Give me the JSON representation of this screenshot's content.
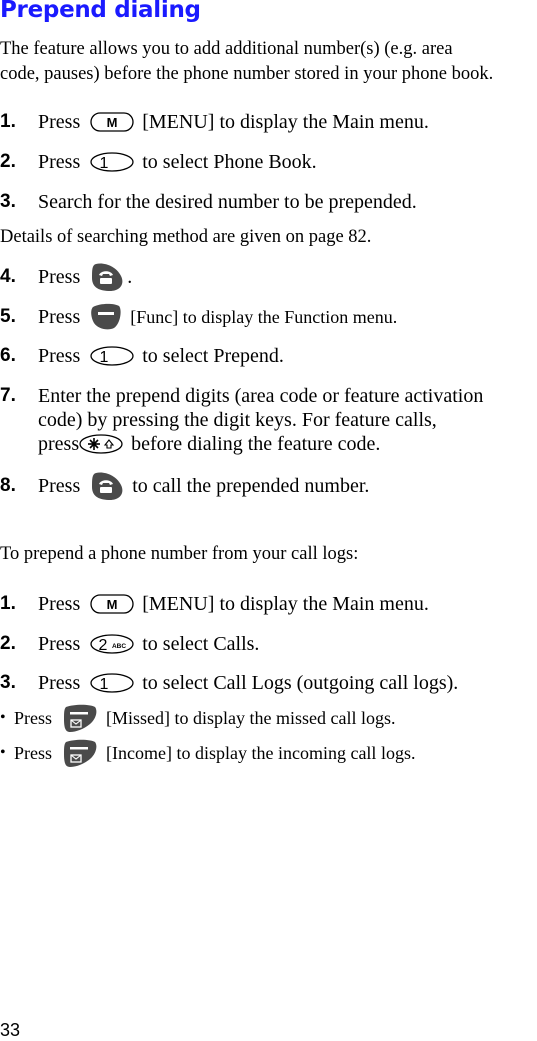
{
  "title": "Prepend dialing",
  "intro": {
    "line1": "The feature allows you to add additional number(s) (e.g. area",
    "line2": "code, pauses) before the phone number stored in your phone book."
  },
  "section1": {
    "steps": [
      {
        "num": "1.",
        "prefix": "Press",
        "key": "menu-key",
        "key_label": "M",
        "suffix": "[MENU] to display the Main menu."
      },
      {
        "num": "2.",
        "prefix": "Press",
        "key": "digit-1-key",
        "key_label": "1",
        "suffix": "to select Phone Book."
      },
      {
        "num": "3.",
        "text": "Search for the desired number to be prepended."
      },
      {
        "num": "4.",
        "prefix": "Press",
        "key": "send-key",
        "suffix": "."
      },
      {
        "num": "5.",
        "prefix": "Press",
        "key": "function-soft-key",
        "suffix": "[Func] to display the Function menu."
      },
      {
        "num": "6.",
        "prefix": "Press",
        "key": "digit-1-key",
        "key_label": "1",
        "suffix": "to select Prepend."
      },
      {
        "num": "7.",
        "line1": "Enter the prepend digits (area code or feature activation",
        "line2": "code) by pressing the digit keys. For feature calls,",
        "line3_prefix": "press",
        "key": "star-key",
        "line3_suffix": "before dialing the feature code."
      },
      {
        "num": "8.",
        "prefix": "Press",
        "key": "send-key",
        "suffix": "to call the prepended number."
      }
    ],
    "note": "Details of searching method are given on page 82."
  },
  "section2": {
    "intro": "To prepend a phone number from your call logs:",
    "steps": [
      {
        "num": "1.",
        "prefix": "Press",
        "key": "menu-key",
        "key_label": "M",
        "suffix": "[MENU] to display the Main menu."
      },
      {
        "num": "2.",
        "prefix": "Press",
        "key": "digit-2-key",
        "key_label": "2",
        "key_sub": "ABC",
        "suffix": "to select Calls."
      },
      {
        "num": "3.",
        "prefix": "Press",
        "key": "digit-1-key",
        "key_label": "1",
        "suffix": "to select Call Logs (outgoing call logs)."
      }
    ],
    "bullets": [
      {
        "bullet": "•",
        "prefix": "Press",
        "key": "message-soft-key",
        "suffix": "[Missed] to display the missed call logs."
      },
      {
        "bullet": "•",
        "prefix": "Press",
        "key": "message-soft-key",
        "suffix": "[Income] to display the incoming call logs."
      }
    ]
  },
  "page_number": "33",
  "colors": {
    "title": "#1a1aff",
    "key_fill": "#4a4a4a"
  }
}
